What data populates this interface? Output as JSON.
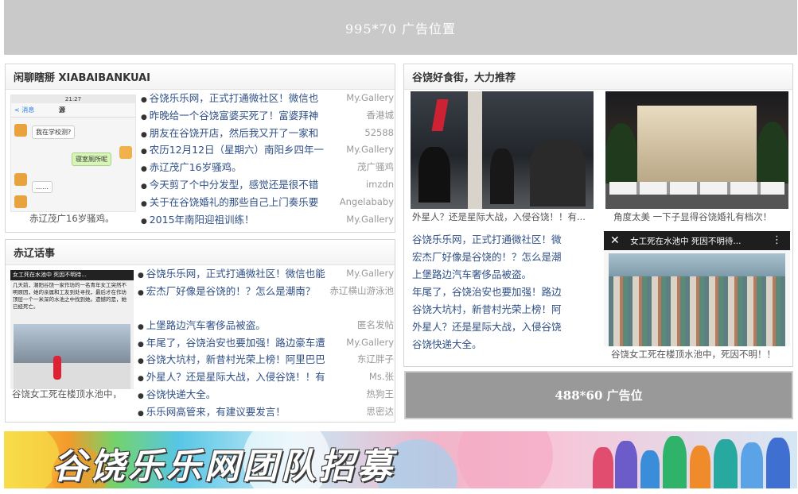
{
  "top_ad": {
    "label": "995*70 广告位置"
  },
  "panel_left_top": {
    "title": "闲聊瞎掰 XIABAIBANKUAI",
    "thumb_caption": "赤辽茂广16岁骚鸡。",
    "chat": {
      "time": "21:27",
      "back": "< 消息",
      "name": "源",
      "msg1": "我在学校测?",
      "msg2": "寝室厕所呢",
      "msg3": "……"
    },
    "items": [
      {
        "title": "谷饶乐乐网，正式打通微社区！微信也",
        "source": "My.Gallery"
      },
      {
        "title": "昨晚给一个谷饶富婆买死了！富婆拜神",
        "source": "香港城"
      },
      {
        "title": "朋友在谷饶开店，然后我又开了一家和",
        "source": "52588"
      },
      {
        "title": "农历12月12日（星期六）南阳乡四年一",
        "source": "My.Gallery"
      },
      {
        "title": "赤辽茂广16岁骚鸡。",
        "source": "茂广骚鸡"
      },
      {
        "title": "今天剪了个中分发型，感觉还是很不错",
        "source": "imzdn"
      },
      {
        "title": "关于在谷饶婚礼的那些自己上门奏乐要",
        "source": "Angelababy"
      },
      {
        "title": "2015年南阳迎祖训练！",
        "source": "My.Gallery"
      }
    ]
  },
  "panel_left_bottom": {
    "title": "赤辽话事",
    "thumb_caption": "谷饶女工死在楼顶水池中，",
    "pic": {
      "headline": "女工死在水池中 死因不明待...",
      "body": "几天前，潮阳谷饶一家作坊的一名青年女工突然不明原因，她的亲属和工友到处寻找，最后才在作坊顶层一个一米深的水池之中找到她。遗憾的是，她已经死亡。"
    },
    "items": [
      {
        "title": "谷饶乐乐网，正式打通微社区！微信也能",
        "source": "My.Gallery"
      },
      {
        "title": "宏杰厂好像是谷饶的！？怎么是潮南？",
        "source": "赤辽横山游泳池"
      },
      {
        "title": "上堡路边汽车奢侈品被盗。",
        "source": "匿名发帖"
      },
      {
        "title": "年尾了，谷饶治安也要加强！路边豪车遭",
        "source": "My.Gallery"
      },
      {
        "title": "谷饶大坑村，新昔村光荣上榜！阿里巴巴",
        "source": "东辽胖子"
      },
      {
        "title": "外星人？还是星际大战，入侵谷饶！！有",
        "source": "Ms.张"
      },
      {
        "title": "谷饶快递大全。",
        "source": "热狗王"
      },
      {
        "title": "乐乐网高管来，有建议要发言！",
        "source": "思密达"
      }
    ]
  },
  "panel_right": {
    "title": "谷饶好食街，大力推荐",
    "photo1_caption": "外星人？还是星际大战，入侵谷饶！！有...",
    "photo2_caption": "角度太美 一下子显得谷饶婚礼有档次！",
    "photo3_caption": "谷饶女工死在楼顶水池中，死因不明！！",
    "photo3_header": "女工死在水池中 死因不明待...",
    "links": [
      "谷饶乐乐网，正式打通微社区！微",
      "宏杰厂好像是谷饶的！？怎么是潮",
      "上堡路边汽车奢侈品被盗。",
      "年尾了，谷饶治安也要加强！路边",
      "谷饶大坑村，新昔村光荣上榜！阿",
      "外星人？还是星际大战，入侵谷饶",
      "谷饶快递大全。"
    ]
  },
  "mid_ad": {
    "label": "488*60 广告位"
  },
  "banner": {
    "text": "谷饶乐乐网团队招募"
  },
  "colors": {
    "link": "#2f4f85",
    "source": "#999999",
    "ad_gray": "#c9c9c9"
  }
}
